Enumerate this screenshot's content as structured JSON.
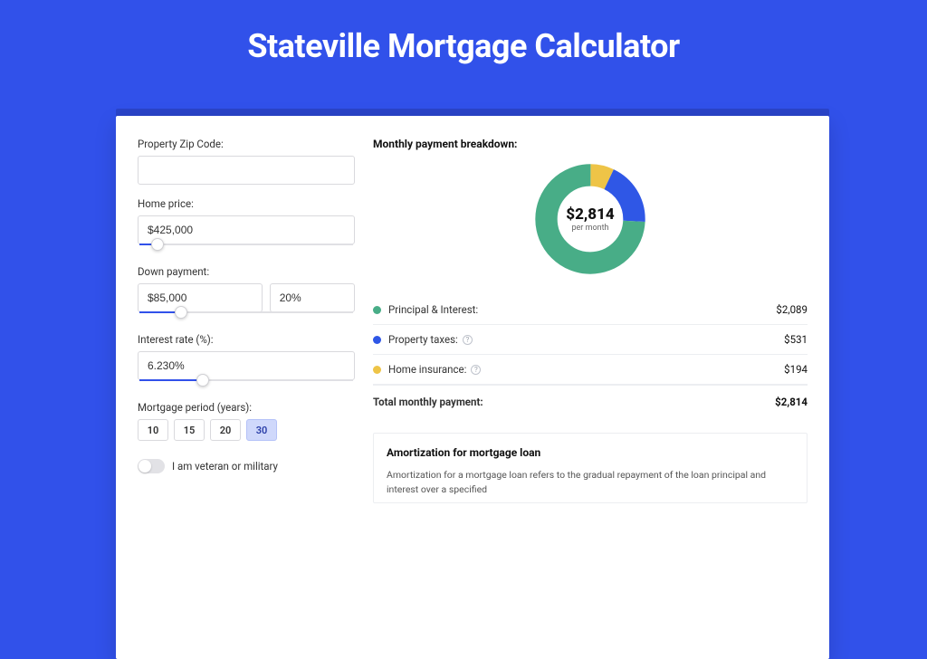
{
  "page": {
    "title": "Stateville Mortgage Calculator"
  },
  "form": {
    "zip": {
      "label": "Property Zip Code:",
      "value": ""
    },
    "home_price": {
      "label": "Home price:",
      "value": "$425,000",
      "slider_pct": 9
    },
    "down_payment": {
      "label": "Down payment:",
      "amount": "$85,000",
      "percent": "20%",
      "slider_pct": 20
    },
    "interest_rate": {
      "label": "Interest rate (%):",
      "value": "6.230%",
      "slider_pct": 30
    },
    "period": {
      "label": "Mortgage period (years):",
      "options": [
        "10",
        "15",
        "20",
        "30"
      ],
      "active_index": 3
    },
    "veteran": {
      "label": "I am veteran or military",
      "on": false
    }
  },
  "breakdown": {
    "title": "Monthly payment breakdown:",
    "center_amount": "$2,814",
    "center_sub": "per month",
    "items": [
      {
        "label": "Principal & Interest:",
        "value": "$2,089",
        "color": "#48ad87",
        "help": false
      },
      {
        "label": "Property taxes:",
        "value": "$531",
        "color": "#2f57e6",
        "help": true
      },
      {
        "label": "Home insurance:",
        "value": "$194",
        "color": "#eec447",
        "help": true
      }
    ],
    "total": {
      "label": "Total monthly payment:",
      "value": "$2,814"
    }
  },
  "chart_data": {
    "type": "pie",
    "title": "Monthly payment breakdown",
    "series": [
      {
        "name": "Principal & Interest",
        "value": 2089,
        "color": "#48ad87"
      },
      {
        "name": "Property taxes",
        "value": 531,
        "color": "#2f57e6"
      },
      {
        "name": "Home insurance",
        "value": 194,
        "color": "#eec447"
      }
    ],
    "total": 2814,
    "center_label": "$2,814 per month"
  },
  "amortization": {
    "title": "Amortization for mortgage loan",
    "text": "Amortization for a mortgage loan refers to the gradual repayment of the loan principal and interest over a specified"
  }
}
